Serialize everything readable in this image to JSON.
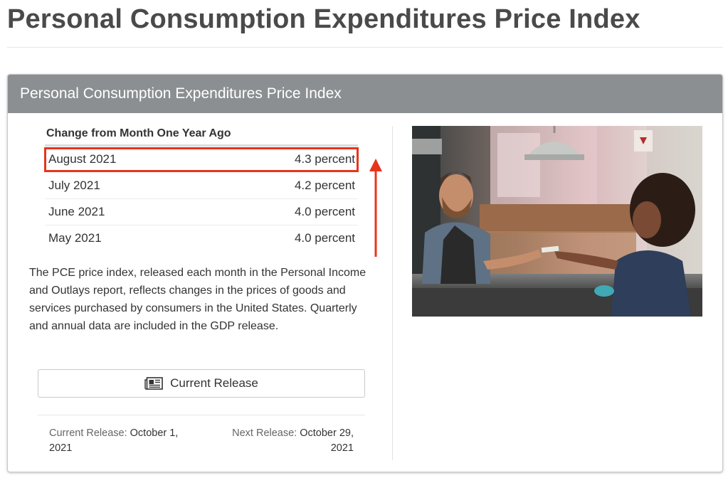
{
  "page": {
    "title": "Personal Consumption Expenditures Price Index"
  },
  "panel": {
    "header": "Personal Consumption Expenditures Price Index",
    "table": {
      "heading": "Change from Month One Year Ago",
      "rows": [
        {
          "month": "August 2021",
          "value": "4.3 percent",
          "highlighted": true
        },
        {
          "month": "July 2021",
          "value": "4.2 percent"
        },
        {
          "month": "June 2021",
          "value": "4.0 percent"
        },
        {
          "month": "May 2021",
          "value": "4.0 percent"
        }
      ]
    },
    "description": "The PCE price index, released each month in the Personal Income and Outlays report, reflects changes in the prices of goods and services purchased by consumers in the United States. Quarterly and annual data are included in the GDP release.",
    "release_button": {
      "label": "Current Release",
      "icon": "newspaper-icon"
    },
    "footer": {
      "current_label": "Current Release:",
      "current_date": "October 1, 2021",
      "next_label": "Next Release:",
      "next_date": "October 29, 2021"
    }
  },
  "colors": {
    "header_bg": "#8c8f91",
    "highlight": "#e8341c",
    "title_text": "#4a4a4a"
  }
}
